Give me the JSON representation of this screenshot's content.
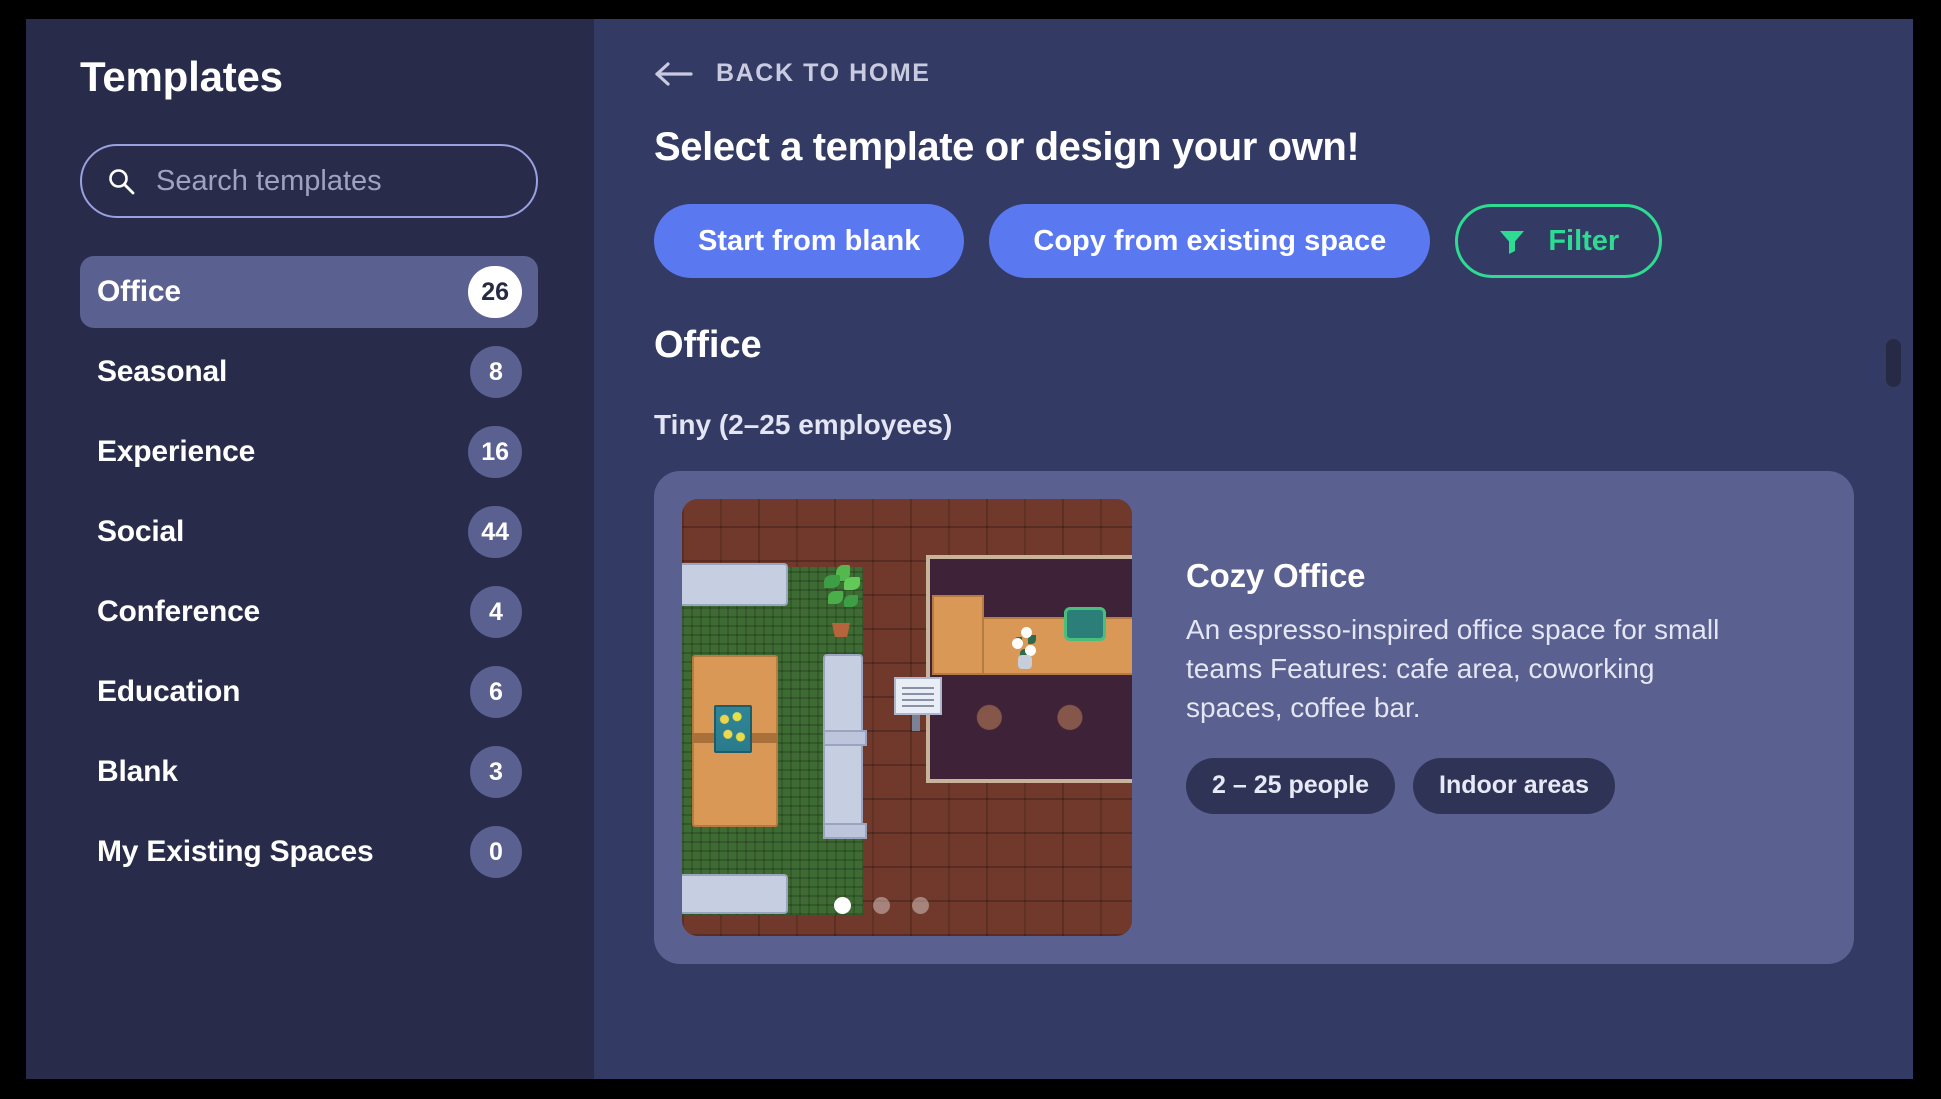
{
  "sidebar": {
    "title": "Templates",
    "search": {
      "placeholder": "Search templates",
      "value": "",
      "icon": "search-icon"
    },
    "items": [
      {
        "label": "Office",
        "count": "26",
        "active": true
      },
      {
        "label": "Seasonal",
        "count": "8",
        "active": false
      },
      {
        "label": "Experience",
        "count": "16",
        "active": false
      },
      {
        "label": "Social",
        "count": "44",
        "active": false
      },
      {
        "label": "Conference",
        "count": "4",
        "active": false
      },
      {
        "label": "Education",
        "count": "6",
        "active": false
      },
      {
        "label": "Blank",
        "count": "3",
        "active": false
      },
      {
        "label": "My Existing Spaces",
        "count": "0",
        "active": false
      }
    ]
  },
  "main": {
    "back_label": "BACK TO HOME",
    "back_icon": "arrow-left-icon",
    "title": "Select a template or design your own!",
    "buttons": {
      "start_blank": "Start from blank",
      "copy_existing": "Copy from existing space",
      "filter": "Filter",
      "filter_icon": "funnel-icon"
    },
    "section_title": "Office",
    "subsection_title": "Tiny (2–25 employees)"
  },
  "card": {
    "title": "Cozy Office",
    "description": "An espresso-inspired office space for small teams Features: cafe area, coworking spaces, coffee bar.",
    "tags": [
      "2 – 25 people",
      "Indoor areas"
    ],
    "carousel": {
      "total": 3,
      "active_index": 0
    }
  },
  "colors": {
    "page_border": "#000000",
    "sidebar_bg": "#282C4A",
    "main_bg": "#333A64",
    "accent_blue": "#5A78F0",
    "accent_green": "#2EDB92",
    "card_bg": "#5A608F",
    "badge_bg": "#5A608F",
    "tag_bg": "#2F3457"
  }
}
